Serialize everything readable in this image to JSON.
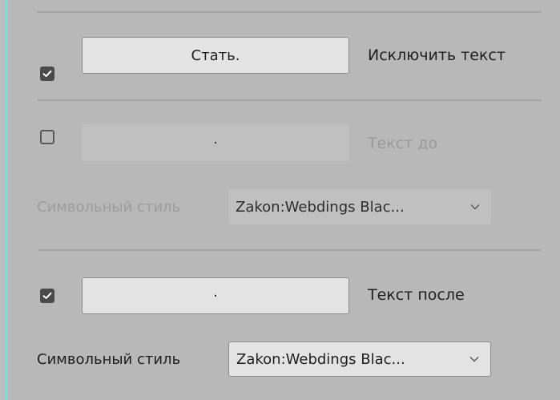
{
  "colors": {
    "panel_bg": "#b8b8b8",
    "accent": "#7fd8da",
    "control_bg": "#e3e3e3",
    "disabled_text": "#9a9a9a"
  },
  "exclude_row": {
    "checked": true,
    "button_label": "Стать.",
    "label": "Исключить текст"
  },
  "text_before_row": {
    "checked": false,
    "button_label": "·",
    "label": "Текст до",
    "char_style_label": "Символьный стиль",
    "char_style_value": "Zakon:Webdings Blac..."
  },
  "text_after_row": {
    "checked": true,
    "button_label": "·",
    "label": "Текст после",
    "char_style_label": "Символьный стиль",
    "char_style_value": "Zakon:Webdings Blac..."
  },
  "icons": {
    "check": "checkmark-icon",
    "dropdown": "chevron-down-icon"
  }
}
